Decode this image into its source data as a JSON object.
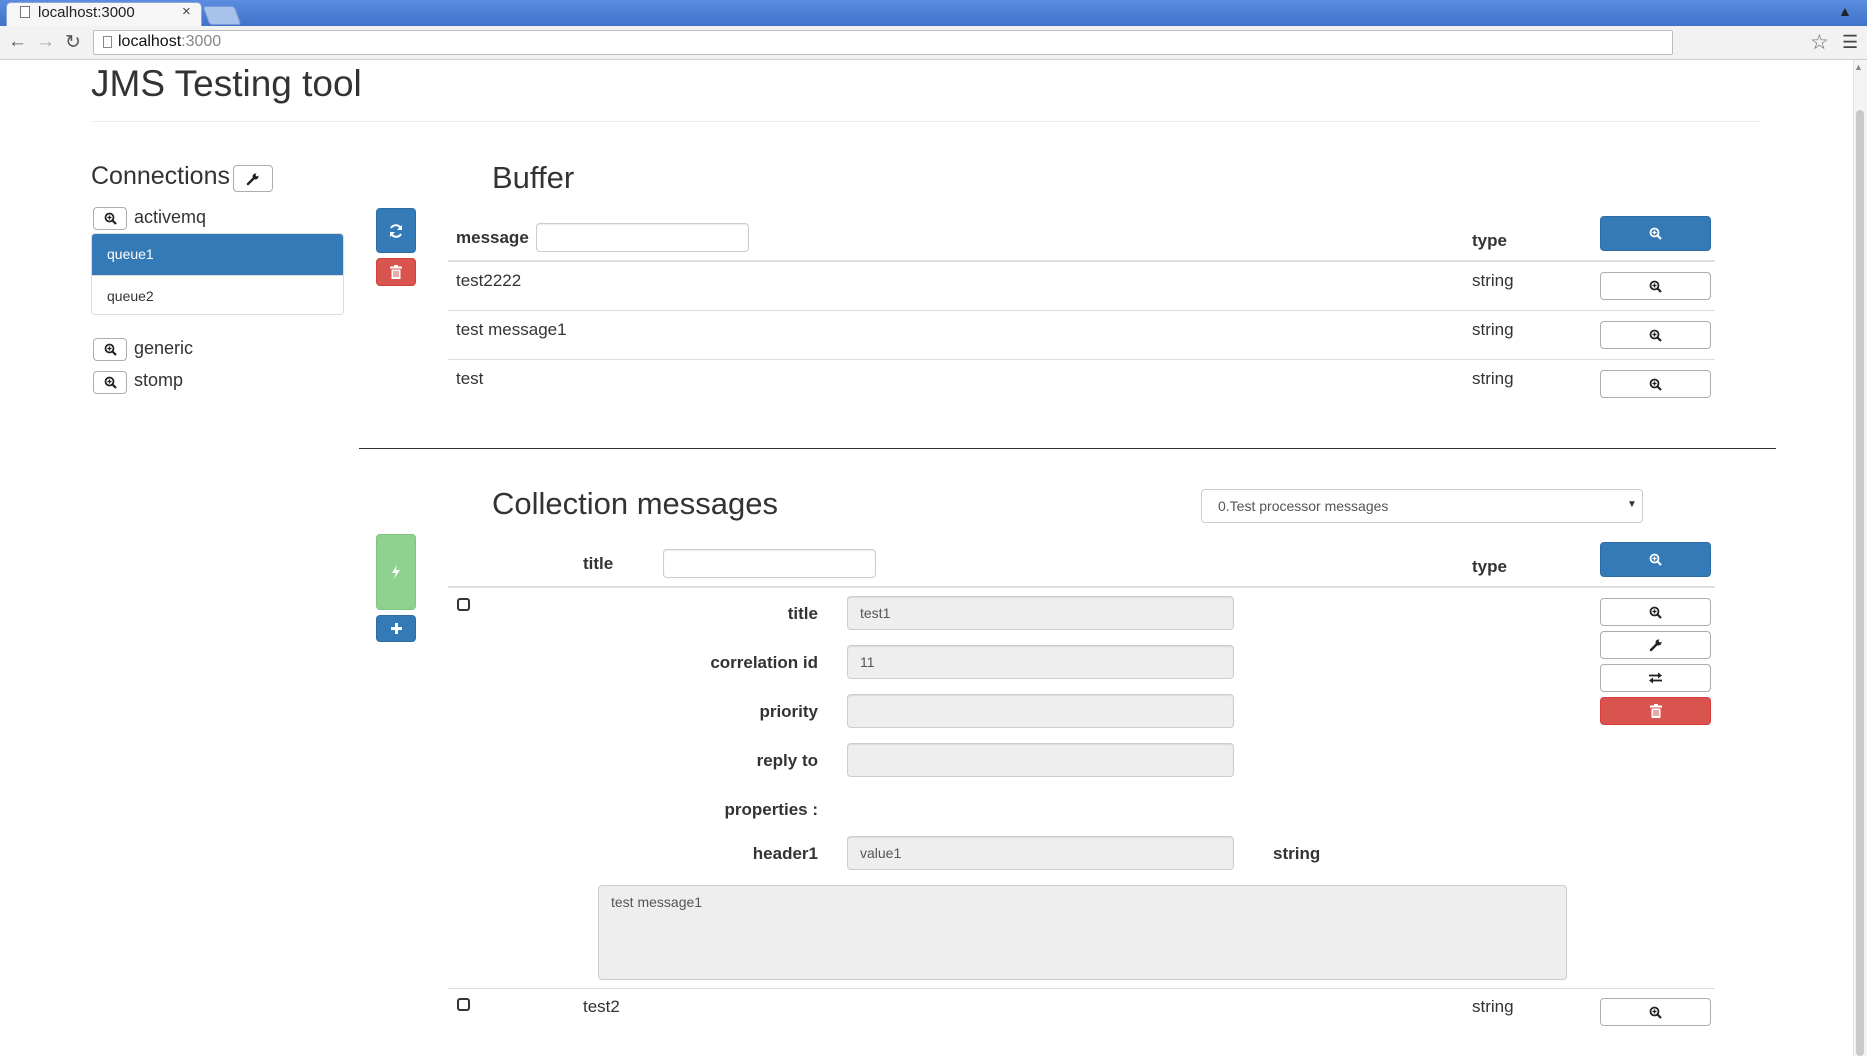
{
  "browser": {
    "tab_title": "localhost:3000",
    "tab_close": "×",
    "url_host": "localhost",
    "url_port": ":3000"
  },
  "page": {
    "title": "JMS Testing tool"
  },
  "connections": {
    "heading": "Connections",
    "groups": [
      {
        "name": "activemq",
        "queues": [
          "queue1",
          "queue2"
        ],
        "selected": "queue1"
      },
      {
        "name": "generic"
      },
      {
        "name": "stomp"
      }
    ]
  },
  "buffer": {
    "heading": "Buffer",
    "filter_label": "message",
    "filter_value": "",
    "type_header": "type",
    "rows": [
      {
        "message": "test2222",
        "type": "string"
      },
      {
        "message": "test message1",
        "type": "string"
      },
      {
        "message": "test",
        "type": "string"
      }
    ]
  },
  "collection": {
    "heading": "Collection messages",
    "selected_collection": "0.Test processor messages",
    "filter_label": "title",
    "filter_value": "",
    "type_header": "type",
    "expanded_item": {
      "fields": {
        "title_label": "title",
        "title_value": "test1",
        "correlation_label": "correlation id",
        "correlation_value": "11",
        "priority_label": "priority",
        "priority_value": "",
        "reply_to_label": "reply to",
        "reply_to_value": "",
        "properties_label": "properties :",
        "property_name": "header1",
        "property_value": "value1",
        "property_type": "string"
      },
      "body": "test message1"
    },
    "rows": [
      {
        "title": "test2",
        "type": "string"
      }
    ]
  },
  "colors": {
    "primary": "#337ab7",
    "danger": "#d9534f",
    "success": "#8fd18f"
  }
}
